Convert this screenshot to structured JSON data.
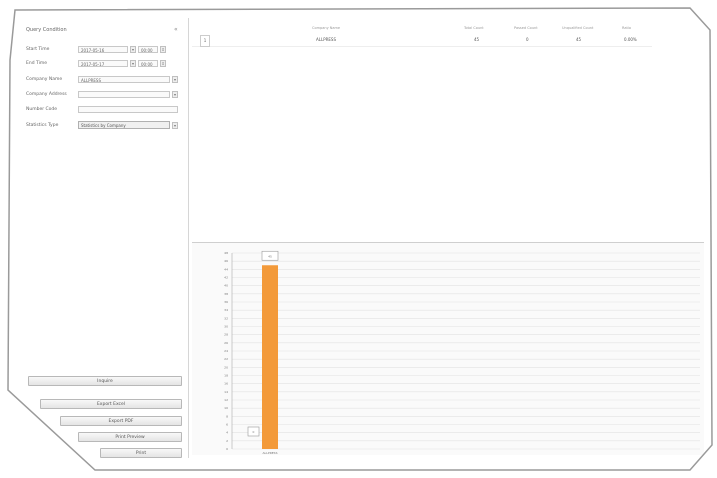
{
  "query_panel": {
    "title": "Query Condition",
    "collapse_glyph": "«",
    "start_time_label": "Start Time",
    "start_date": "2017-05-16",
    "start_clock": "00:00",
    "end_time_label": "End Time",
    "end_date": "2017-05-17",
    "end_clock": "00:00",
    "company_name_label": "Company Name",
    "company_name_value": "ALLPRESS",
    "company_address_label": "Company Address",
    "company_address_value": "",
    "number_code_label": "Number Code",
    "number_code_value": "",
    "statistics_type_label": "Statistics Type",
    "statistics_type_value": "Statistics by Company",
    "calendar_icon": "calendar-icon",
    "spinner_icon": "spinner-icon",
    "dropdown_icon": "chevron-down-icon"
  },
  "buttons": {
    "query": "Inquire",
    "export_excel": "Export Excel",
    "export_pdf": "Export PDF",
    "print_preview": "Print Preview",
    "print": "Print"
  },
  "table": {
    "columns": [
      "Company Name",
      "Total Count",
      "Passed Count",
      "Unqualified Count",
      "Ratio"
    ],
    "rows": [
      {
        "index": "1",
        "company": "ALLPRESS",
        "total": "45",
        "passed": "0",
        "unqualified": "45",
        "ratio": "0.00%"
      }
    ]
  },
  "chart_data": {
    "type": "bar",
    "categories": [
      "ALLPRESS"
    ],
    "series": [
      {
        "values": [
          45
        ],
        "data_labels": [
          "45"
        ]
      }
    ],
    "baseline_label": "0",
    "ylim": [
      0,
      48
    ],
    "yticks": [
      0,
      2,
      4,
      6,
      8,
      10,
      12,
      14,
      16,
      18,
      20,
      22,
      24,
      26,
      28,
      30,
      32,
      34,
      36,
      38,
      40,
      42,
      44,
      46,
      48
    ],
    "grid": true,
    "bar_color": "#f39a3a"
  }
}
